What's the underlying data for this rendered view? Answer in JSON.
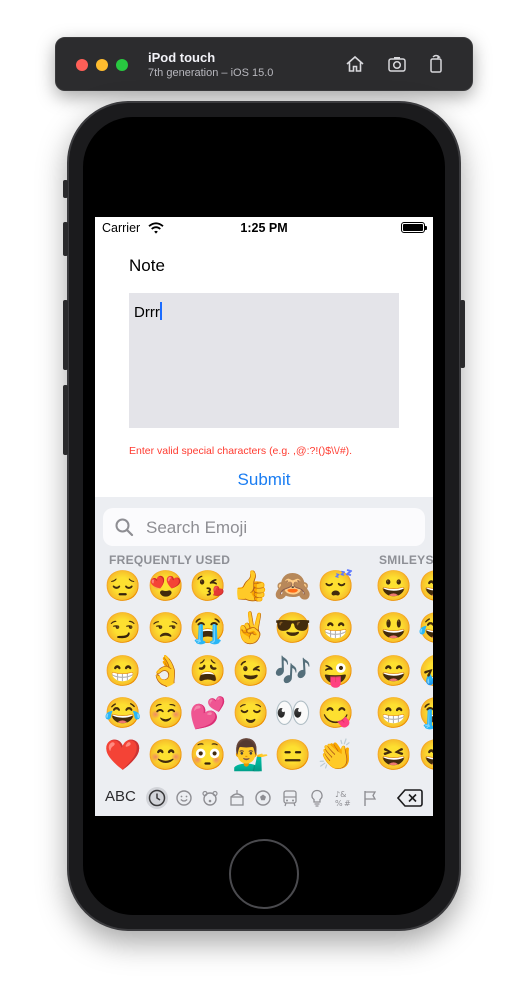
{
  "simulator": {
    "device_name": "iPod touch",
    "device_subtitle": "7th generation – iOS 15.0",
    "toolbar_icons": [
      "home-icon",
      "screenshot-icon",
      "rotate-icon"
    ]
  },
  "status_bar": {
    "carrier": "Carrier",
    "time": "1:25 PM"
  },
  "form": {
    "title": "Note",
    "note_value": "Drrr",
    "error_message": "Enter valid special characters (e.g. ,@:?!()$\\\\/#).",
    "submit_label": "Submit"
  },
  "emoji_keyboard": {
    "search_placeholder": "Search Emoji",
    "section_frequently_used": "FREQUENTLY USED",
    "section_smileys": "SMILEYS",
    "frequently_used_columns": [
      [
        "😔",
        "😏",
        "😁",
        "😂",
        "❤️"
      ],
      [
        "😍",
        "😒",
        "👌",
        "☺️",
        "😊"
      ],
      [
        "😘",
        "😭",
        "😩",
        "💕",
        "😳"
      ],
      [
        "👍",
        "✌️",
        "😉",
        "😌",
        "💁‍♂️"
      ],
      [
        "🙈",
        "😎",
        "🎶",
        "👀",
        "😑"
      ],
      [
        "😴",
        "😁",
        "😜",
        "😋",
        "👏"
      ]
    ],
    "smileys_columns": [
      [
        "😀",
        "😃",
        "😄",
        "😁",
        "😆"
      ],
      [
        "😅",
        "😂",
        "🤣",
        "😭",
        "😅"
      ]
    ],
    "abc_label": "ABC",
    "category_icons": [
      "recent-clock-icon",
      "smiley-icon",
      "animal-icon",
      "food-icon",
      "sport-ball-icon",
      "travel-icon",
      "lightbulb-icon",
      "symbols-icon",
      "flag-icon"
    ],
    "delete_icon": "delete-backspace-icon"
  }
}
